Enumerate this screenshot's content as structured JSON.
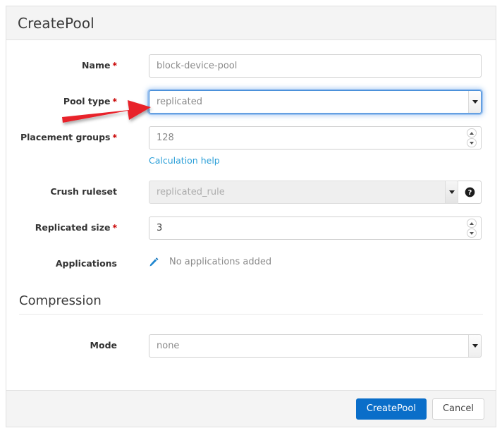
{
  "dialog": {
    "title": "CreatePool"
  },
  "form": {
    "name": {
      "label": "Name",
      "required_marker": "*",
      "value": "block-device-pool"
    },
    "pool_type": {
      "label": "Pool type",
      "required_marker": "*",
      "value": "replicated"
    },
    "placement_groups": {
      "label": "Placement groups",
      "required_marker": "*",
      "value": "128",
      "help_link": "Calculation help"
    },
    "crush_ruleset": {
      "label": "Crush ruleset",
      "value": "replicated_rule",
      "help_icon": "question-circle-icon"
    },
    "replicated_size": {
      "label": "Replicated size",
      "required_marker": "*",
      "value": "3"
    },
    "applications": {
      "label": "Applications",
      "edit_icon": "pencil-icon",
      "value": "No applications added"
    }
  },
  "compression": {
    "legend": "Compression",
    "mode": {
      "label": "Mode",
      "value": "none"
    }
  },
  "footer": {
    "submit_label": "CreatePool",
    "cancel_label": "Cancel"
  },
  "annotation": {
    "type": "arrow",
    "color": "#e8212a",
    "points_at": "pool-type-select"
  },
  "colors": {
    "primary_button": "#0a6ec9",
    "link": "#2b9fd8",
    "required_asterisk": "#c80000",
    "header_background": "#f4f4f4",
    "focus_ring": "#3c87d6",
    "annotation_red": "#e8212a"
  }
}
